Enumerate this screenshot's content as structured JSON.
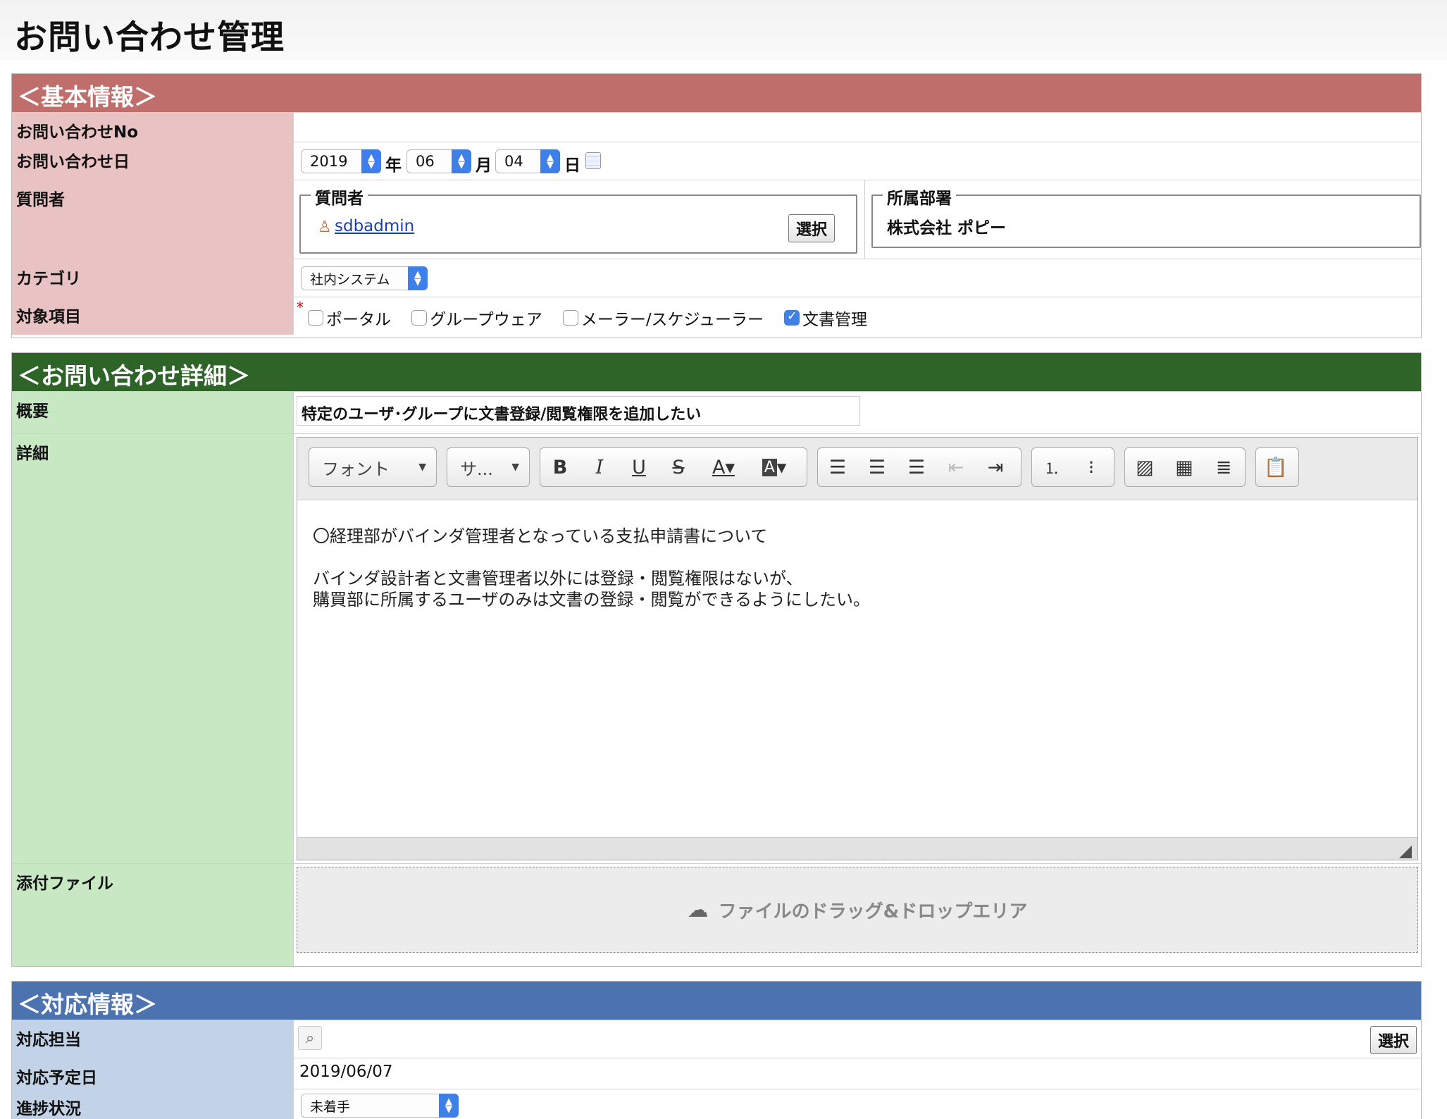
{
  "page": {
    "title": "お問い合わせ管理"
  },
  "basic": {
    "header": "＜基本情報＞",
    "inquiry_no_label": "お問い合わせNo",
    "inquiry_no_value": "",
    "date_label": "お問い合わせ日",
    "year": "2019",
    "year_unit": "年",
    "month": "06",
    "month_unit": "月",
    "day": "04",
    "day_unit": "日",
    "asker_label": "質問者",
    "asker_legend": "質問者",
    "asker_user": "sdbadmin",
    "select_button": "選択",
    "dept_legend": "所属部署",
    "dept_value": "株式会社 ポピー",
    "category_label": "カテゴリ",
    "category_value": "社内システム",
    "target_label": "対象項目",
    "required_mark": "*",
    "targets": [
      {
        "label": "ポータル",
        "checked": false
      },
      {
        "label": "グループウェア",
        "checked": false
      },
      {
        "label": "メーラー/スケジューラー",
        "checked": false
      },
      {
        "label": "文書管理",
        "checked": true
      }
    ]
  },
  "detail": {
    "header": "＜お問い合わせ詳細＞",
    "summary_label": "概要",
    "summary_value": "特定のユーザ･グループに文書登録/閲覧権限を追加したい",
    "detail_label": "詳細",
    "toolbar": {
      "font": "フォント",
      "size": "サ..."
    },
    "body_lines": [
      "〇経理部がバインダ管理者となっている支払申請書について",
      "",
      "バインダ設計者と文書管理者以外には登録・閲覧権限はないが、",
      "購買部に所属するユーザのみは文書の登録・閲覧ができるようにしたい。"
    ],
    "attach_label": "添付ファイル",
    "drop_text": "ファイルのドラッグ&ドロップエリア"
  },
  "response": {
    "header": "＜対応情報＞",
    "owner_label": "対応担当",
    "select_button": "選択",
    "due_label": "対応予定日",
    "due_value": "2019/06/07",
    "status_label": "進捗状況",
    "status_value": "未着手"
  },
  "colors": {
    "basic": "#c06e6b",
    "detail": "#2f6428",
    "response": "#4d72b0",
    "accent": "#3f7fe8",
    "link": "#1a3fb0"
  },
  "icons": [
    "calendar-icon",
    "user-icon",
    "upload-cloud-icon",
    "search-icon"
  ]
}
